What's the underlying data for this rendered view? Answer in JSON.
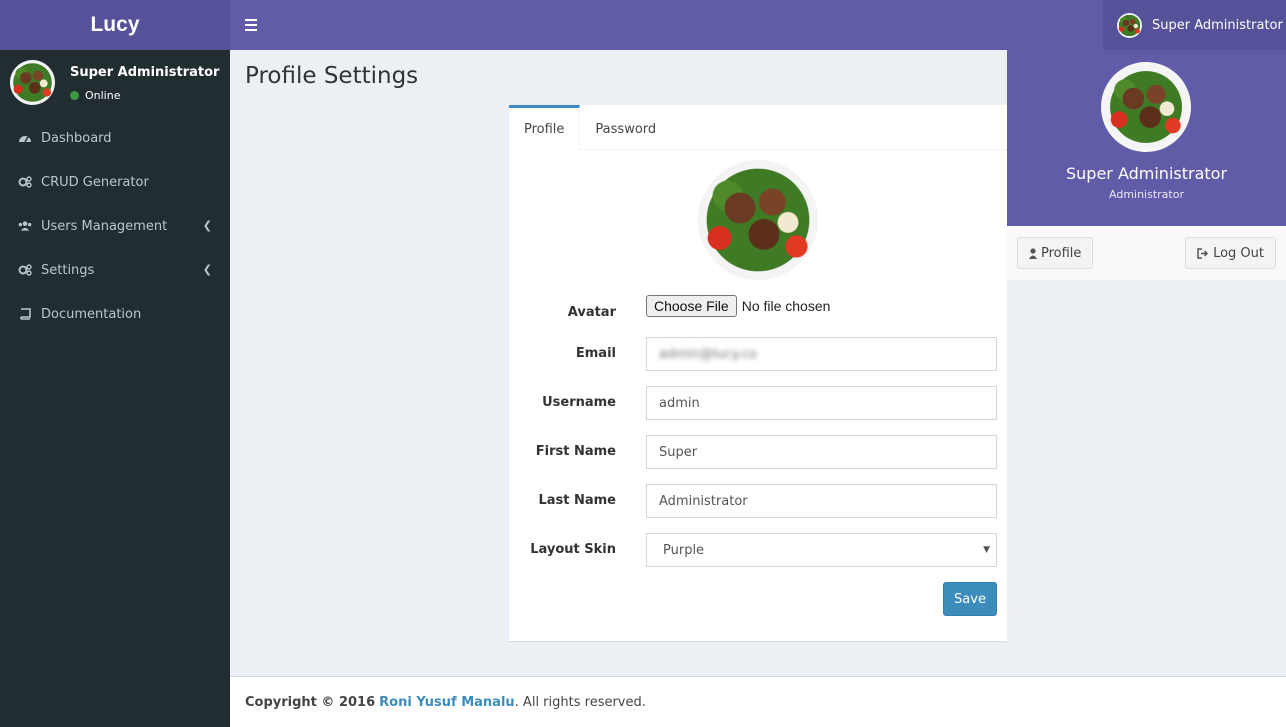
{
  "app": {
    "logo": "Lucy"
  },
  "header": {
    "user_name": "Super Administrator"
  },
  "sidebar": {
    "user_name": "Super Administrator",
    "status": "Online",
    "items": [
      {
        "label": "Dashboard",
        "icon": "dashboard-icon"
      },
      {
        "label": "CRUD Generator",
        "icon": "gears-icon"
      },
      {
        "label": "Users Management",
        "icon": "users-icon",
        "has_children": true
      },
      {
        "label": "Settings",
        "icon": "gears-icon",
        "has_children": true
      },
      {
        "label": "Documentation",
        "icon": "book-icon"
      }
    ]
  },
  "page": {
    "title": "Profile Settings"
  },
  "tabs": [
    {
      "label": "Profile",
      "active": true
    },
    {
      "label": "Password",
      "active": false
    }
  ],
  "form": {
    "avatar_label": "Avatar",
    "file_button": "Choose File",
    "file_status": "No file chosen",
    "email_label": "Email",
    "email_value": "admin@lucy.co",
    "username_label": "Username",
    "username_value": "admin",
    "first_name_label": "First Name",
    "first_name_value": "Super",
    "last_name_label": "Last Name",
    "last_name_value": "Administrator",
    "skin_label": "Layout Skin",
    "skin_value": "Purple",
    "save_label": "Save"
  },
  "dropdown": {
    "name": "Super Administrator",
    "role": "Administrator",
    "profile_label": "Profile",
    "logout_label": "Log Out"
  },
  "footer": {
    "copyright": "Copyright © 2016",
    "author": "Roni Yusuf Manalu",
    "rights": ". All rights reserved."
  },
  "colors": {
    "brand": "#605ca8",
    "brand_dark": "#555299",
    "sidebar": "#222d32",
    "primary": "#3c8dbc",
    "online": "#3c9a41"
  }
}
